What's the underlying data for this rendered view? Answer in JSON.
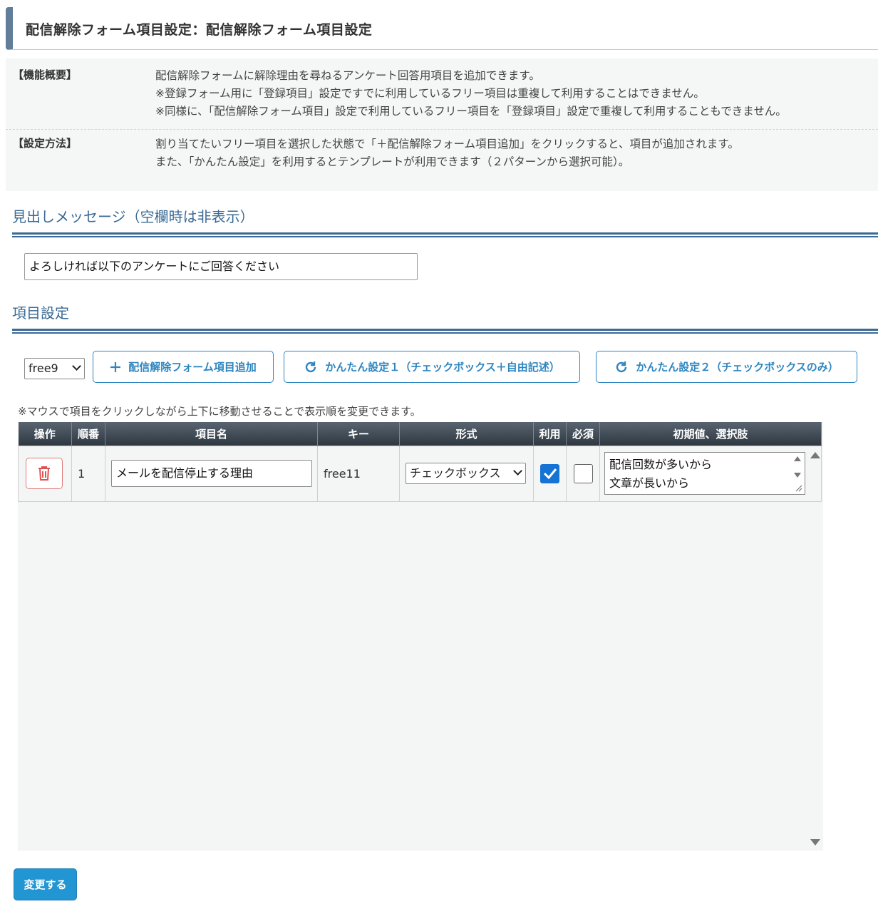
{
  "header": {
    "title": "配信解除フォーム項目設定：配信解除フォーム項目設定"
  },
  "info": {
    "overview_label": "【機能概要】",
    "overview_lines": [
      "配信解除フォームに解除理由を尋ねるアンケート回答用項目を追加できます。",
      "※登録フォーム用に「登録項目」設定ですでに利用しているフリー項目は重複して利用することはできません。",
      "※同様に、「配信解除フォーム項目」設定で利用しているフリー項目を「登録項目」設定で重複して利用することもできません。"
    ],
    "method_label": "【設定方法】",
    "method_lines": [
      "割り当てたいフリー項目を選択した状態で「＋配信解除フォーム項目追加」をクリックすると、項目が追加されます。",
      "また、「かんたん設定」を利用するとテンプレートが利用できます（２パターンから選択可能）。"
    ]
  },
  "heading_section": {
    "title": "見出しメッセージ（空欄時は非表示）",
    "input_value": "よろしければ以下のアンケートにご回答ください"
  },
  "items_section": {
    "title": "項目設定",
    "free_select_value": "free9",
    "add_button": "配信解除フォーム項目追加",
    "easy1_button": "かんたん設定１（チェックボックス＋自由記述）",
    "easy2_button": "かんたん設定２（チェックボックスのみ）",
    "note": "※マウスで項目をクリックしながら上下に移動させることで表示順を変更できます。"
  },
  "table": {
    "headers": [
      "操作",
      "順番",
      "項目名",
      "キー",
      "形式",
      "利用",
      "必須",
      "初期値、選択肢"
    ],
    "rows": [
      {
        "order": "1",
        "name": "メールを配信停止する理由",
        "key": "free11",
        "type": "チェックボックス",
        "use": true,
        "required": false,
        "options_lines": [
          "配信回数が多いから",
          "文章が長いから"
        ]
      }
    ]
  },
  "submit_label": "変更する",
  "colors": {
    "accent": "#2e86c1",
    "section": "#3a6a95",
    "delete": "#e07b7b",
    "checkbox": "#1473d4"
  }
}
